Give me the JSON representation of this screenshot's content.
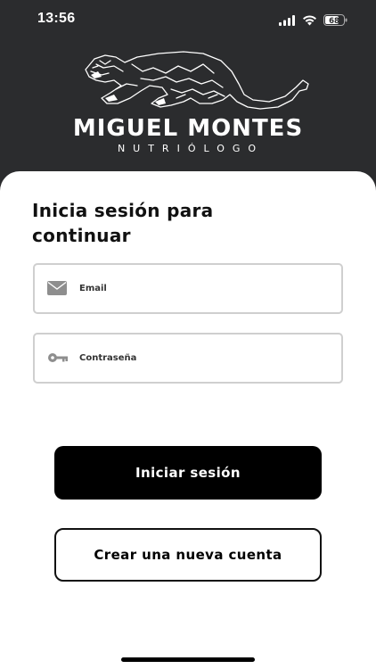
{
  "status_bar": {
    "time": "13:56",
    "battery_level": "68",
    "icons": [
      "signal-icon",
      "wifi-icon",
      "battery-icon"
    ]
  },
  "brand": {
    "name": "MIGUEL MONTES",
    "subtitle": "NUTRIÓLOGO",
    "logo_icon": "panther-logo"
  },
  "login": {
    "title_line1": "Inicia sesión para",
    "title_line2": "continuar",
    "email_placeholder": "Email",
    "email_icon": "mail-icon",
    "password_placeholder": "Contraseña",
    "password_icon": "key-icon",
    "login_button": "Iniciar sesión",
    "signup_button": "Crear una nueva cuenta"
  },
  "colors": {
    "header_bg": "#2b2c2e",
    "primary_button": "#000000",
    "field_border": "#cfcfcf"
  }
}
